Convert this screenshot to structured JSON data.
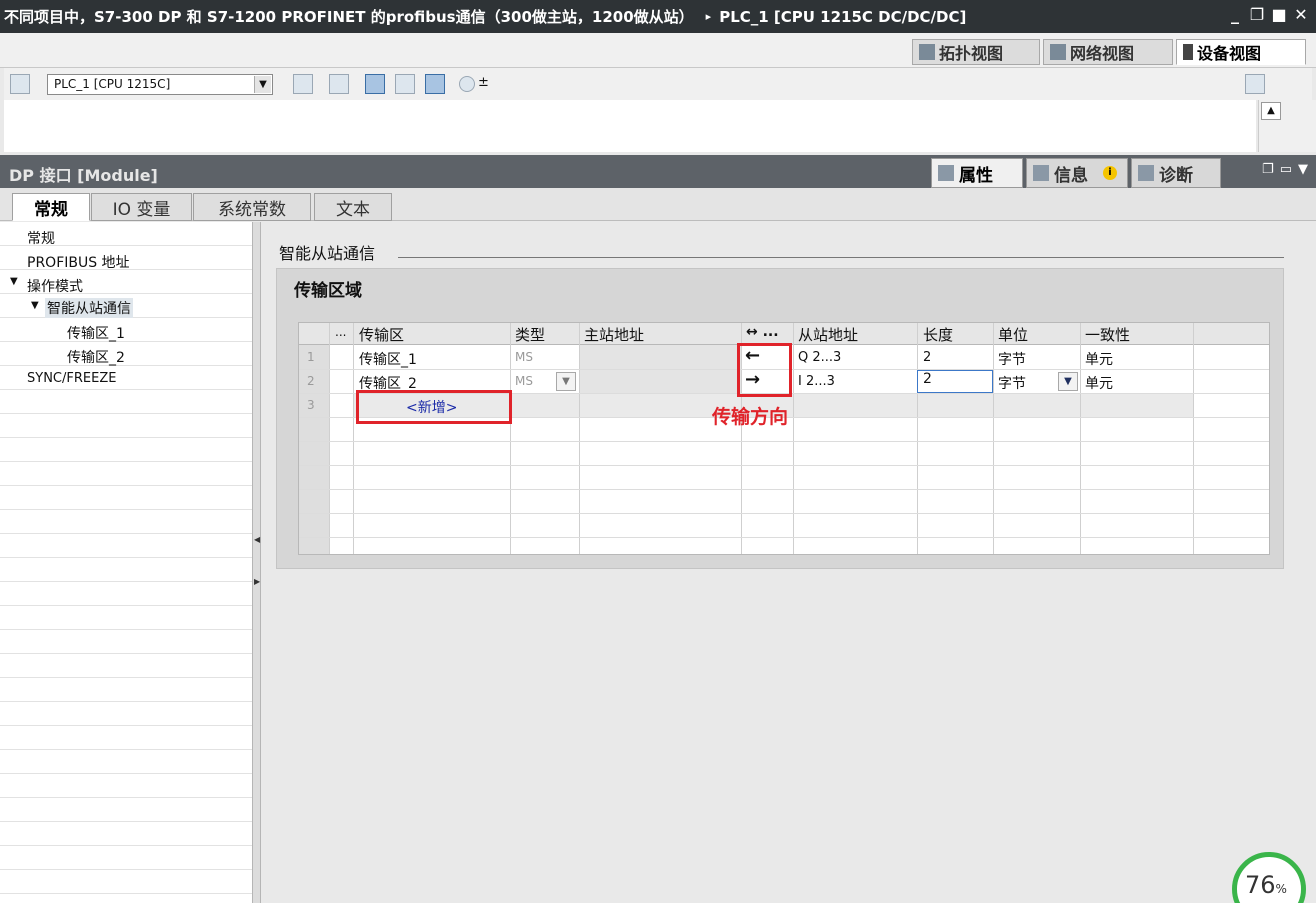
{
  "window": {
    "title": "不同项目中，S7-300 DP 和 S7-1200 PROFINET 的profibus通信（300做主站，1200做从站）",
    "breadcrumb_sep": "▸",
    "device": "PLC_1 [CPU 1215C DC/DC/DC]",
    "controls": {
      "minimize": "_",
      "restore": "❐",
      "maximize": "■",
      "close": "✕"
    }
  },
  "view_tabs": [
    {
      "label": "拓扑视图",
      "icon": "topology-view-icon"
    },
    {
      "label": "网络视图",
      "icon": "network-view-icon"
    },
    {
      "label": "设备视图",
      "icon": "device-view-icon",
      "active": true
    }
  ],
  "toolbar": {
    "device_select": "PLC_1 [CPU 1215C]",
    "zoom_label": "±"
  },
  "inspector": {
    "title": "DP 接口 [Module]",
    "panel_tabs": [
      {
        "label": "属性",
        "active": true
      },
      {
        "label": "信息",
        "info_badge": "i"
      },
      {
        "label": "诊断"
      }
    ],
    "tabs": [
      {
        "label": "常规",
        "active": true
      },
      {
        "label": "IO 变量"
      },
      {
        "label": "系统常数"
      },
      {
        "label": "文本"
      }
    ]
  },
  "nav": {
    "items": [
      {
        "label": "常规",
        "level": 0
      },
      {
        "label": "PROFIBUS 地址",
        "level": 0
      },
      {
        "label": "操作模式",
        "level": 0,
        "expanded": true
      },
      {
        "label": "智能从站通信",
        "level": 1,
        "expanded": true,
        "selected": true
      },
      {
        "label": "传输区_1",
        "level": 2
      },
      {
        "label": "传输区_2",
        "level": 2
      },
      {
        "label": "SYNC/FREEZE",
        "level": 0
      }
    ],
    "expand_glyph": "▼"
  },
  "content": {
    "section_title": "智能从站通信",
    "panel_title": "传输区域",
    "grid": {
      "headers": [
        "...",
        "传输区",
        "类型",
        "主站地址",
        "↔ ...",
        "从站地址",
        "长度",
        "单位",
        "一致性"
      ],
      "rows": [
        {
          "index": "1",
          "name": "传输区_1",
          "type": "MS",
          "master": "",
          "direction": "←",
          "slave": "Q 2...3",
          "length": "2",
          "unit": "字节",
          "consistency": "单元"
        },
        {
          "index": "2",
          "name": "传输区_2",
          "type": "MS",
          "master": "",
          "direction": "→",
          "slave": "I 2...3",
          "length": "2",
          "unit": "字节",
          "consistency": "单元"
        },
        {
          "index": "3",
          "name": "<新增>"
        }
      ]
    },
    "annotation": "传输方向"
  },
  "gauge": {
    "value": "76",
    "unit": "%"
  }
}
